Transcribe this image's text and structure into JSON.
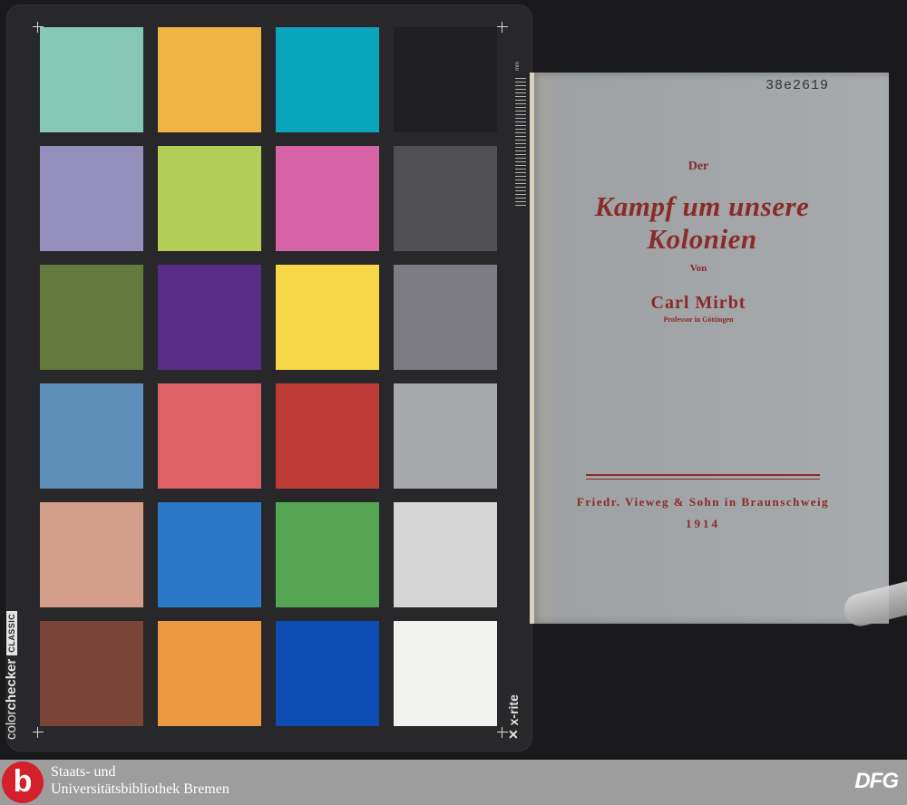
{
  "checker": {
    "brand_left_light": "color",
    "brand_left_bold": "checker",
    "brand_left_tag": "CLASSIC",
    "brand_right": "x-rite",
    "ruler_unit": "mm",
    "patch_colors": [
      [
        "#86c8b5",
        "#efb346",
        "#0aa4bd",
        "#202022"
      ],
      [
        "#958fbe",
        "#b3cd58",
        "#d563a6",
        "#505052"
      ],
      [
        "#63793e",
        "#582d86",
        "#f7d647",
        "#7d7c82"
      ],
      [
        "#5e8fbb",
        "#dd6167",
        "#be3c36",
        "#a7a8aa"
      ],
      [
        "#d39f8b",
        "#2a78c6",
        "#55a552",
        "#d6d6d6"
      ],
      [
        "#7a4538",
        "#ec9a40",
        "#0d4db3",
        "#f1f1ef"
      ]
    ]
  },
  "book": {
    "shelfmark": "38e2619",
    "article": "Der",
    "title": "Kampf um unsere Kolonien",
    "by": "Von",
    "author": "Carl Mirbt",
    "author_role": "Professor in Göttingen",
    "publisher": "Friedr. Vieweg & Sohn in Braunschweig",
    "year": "1914",
    "ink_color": "#8a2b28"
  },
  "footer": {
    "logo_letter": "b",
    "library_line1": "Staats- und",
    "library_line2": "Universitätsbibliothek Bremen",
    "funder": "DFG",
    "logo_color": "#d4202a"
  }
}
